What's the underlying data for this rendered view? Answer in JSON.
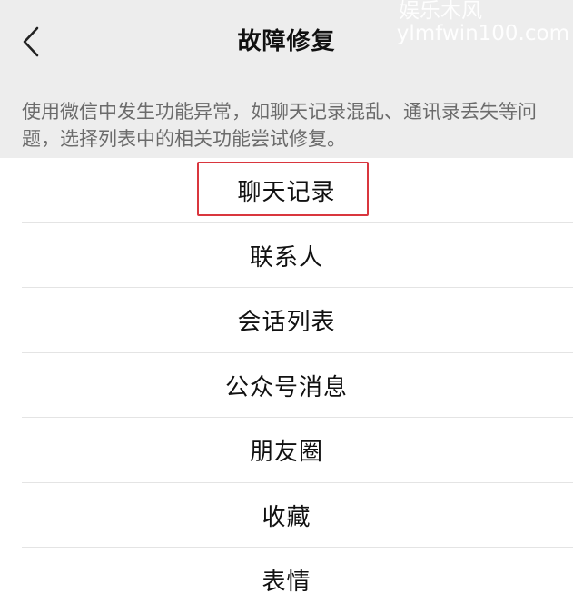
{
  "header": {
    "title": "故障修复",
    "back_icon": "chevron-left-icon"
  },
  "watermark": {
    "cn": "娱乐木风",
    "en": "ylmfwin100.com"
  },
  "description": "使用微信中发生功能异常，如聊天记录混乱、通讯录丢失等问题，选择列表中的相关功能尝试修复。",
  "items": [
    {
      "label": "聊天记录",
      "highlighted": true
    },
    {
      "label": "联系人"
    },
    {
      "label": "会话列表"
    },
    {
      "label": "公众号消息"
    },
    {
      "label": "朋友圈"
    },
    {
      "label": "收藏"
    },
    {
      "label": "表情"
    }
  ],
  "colors": {
    "header_bg": "#ededed",
    "highlight": "#d9363e",
    "text": "#111111",
    "secondary_text": "#6b6b6b"
  }
}
